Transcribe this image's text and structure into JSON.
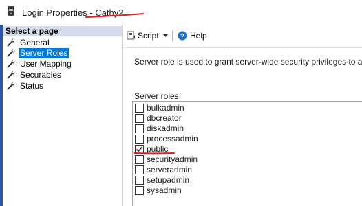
{
  "window": {
    "title": "Login Properties - Cathy2",
    "title_prefix": "Login Properties - ",
    "title_user": "Cathy2",
    "app_icon": "server-document-icon"
  },
  "left_pane": {
    "header": "Select a page",
    "items": [
      {
        "label": "General",
        "icon": "wrench-icon",
        "selected": false
      },
      {
        "label": "Server Roles",
        "icon": "wrench-icon",
        "selected": true
      },
      {
        "label": "User Mapping",
        "icon": "wrench-icon",
        "selected": false
      },
      {
        "label": "Securables",
        "icon": "wrench-icon",
        "selected": false
      },
      {
        "label": "Status",
        "icon": "wrench-icon",
        "selected": false
      }
    ]
  },
  "toolbar": {
    "script_label": "Script",
    "help_label": "Help"
  },
  "main": {
    "description": "Server role is used to grant server-wide security privileges to a user.",
    "roles_label": "Server roles:",
    "roles": [
      {
        "name": "bulkadmin",
        "checked": false
      },
      {
        "name": "dbcreator",
        "checked": false
      },
      {
        "name": "diskadmin",
        "checked": false
      },
      {
        "name": "processadmin",
        "checked": false
      },
      {
        "name": "public",
        "checked": true
      },
      {
        "name": "securityadmin",
        "checked": false
      },
      {
        "name": "serveradmin",
        "checked": false
      },
      {
        "name": "setupadmin",
        "checked": false
      },
      {
        "name": "sysadmin",
        "checked": false
      }
    ]
  },
  "colors": {
    "selection": "#0078d7",
    "annotation": "#e02020",
    "header_bg": "#d6dbe9",
    "accent": "#2f55a3"
  }
}
